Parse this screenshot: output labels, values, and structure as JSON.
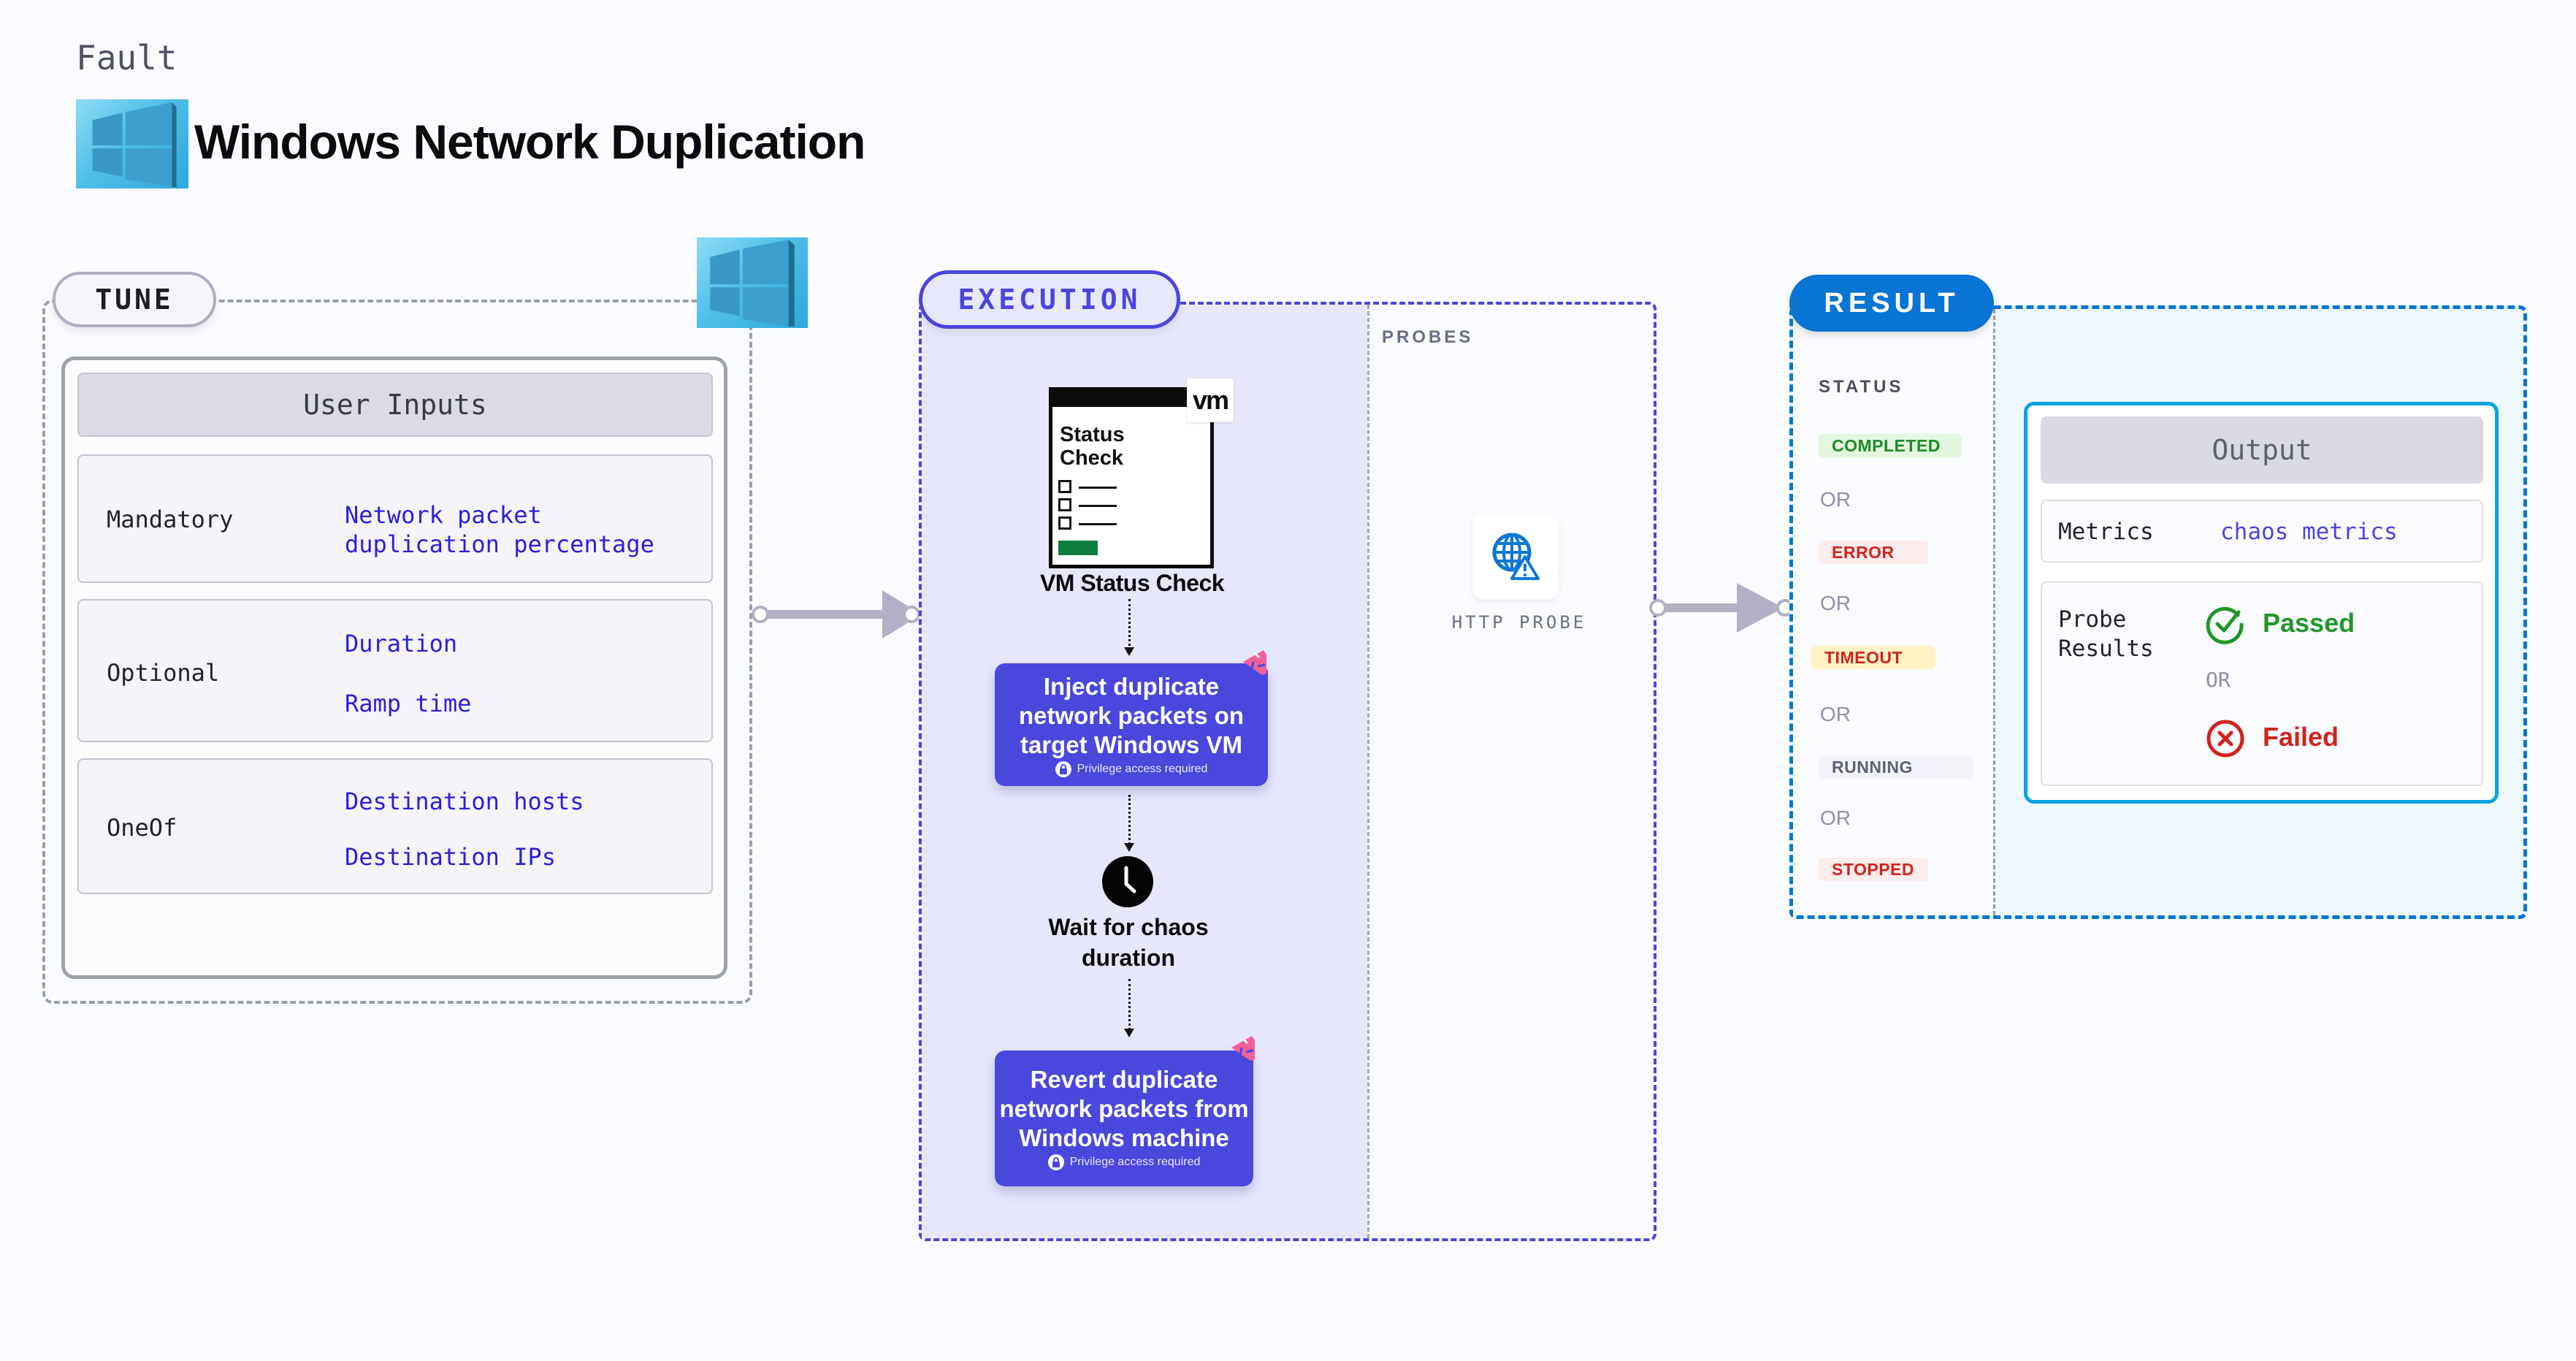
{
  "header": {
    "category": "Fault",
    "title": "Windows Network Duplication",
    "title_icon": "windows-logo-icon"
  },
  "tune": {
    "label": "TUNE",
    "icon": "windows-logo-icon",
    "card_title": "User Inputs",
    "rows": [
      {
        "label": "Mandatory",
        "values": [
          "Network packet",
          "duplication percentage"
        ]
      },
      {
        "label": "Optional",
        "values": [
          "Duration",
          "Ramp time"
        ]
      },
      {
        "label": "OneOf",
        "values": [
          "Destination hosts",
          "Destination IPs"
        ]
      }
    ]
  },
  "execution": {
    "label": "EXECUTION",
    "probes_label": "PROBES",
    "status_check": {
      "doc_title_line1": "Status",
      "doc_title_line2": "Check",
      "badge": "vm",
      "caption": "VM Status Check"
    },
    "steps": [
      {
        "title_lines": [
          "Inject duplicate",
          "network packets on",
          "target Windows VM"
        ],
        "note": "Privilege access required"
      },
      {
        "title_lines": [
          "Revert duplicate",
          "network packets from",
          "Windows machine"
        ],
        "note": "Privilege access required"
      }
    ],
    "wait": {
      "lines": [
        "Wait for chaos",
        "duration"
      ]
    },
    "probe": {
      "label": "HTTP PROBE",
      "icon": "globe-warning-icon"
    }
  },
  "result": {
    "label": "RESULT",
    "status_heading": "STATUS",
    "or_text": "OR",
    "statuses": [
      {
        "label": "COMPLETED",
        "text_color": "#1e8a2a",
        "bg_color": "#e3f6df"
      },
      {
        "label": "ERROR",
        "text_color": "#d0231f",
        "bg_color": "#fdecec"
      },
      {
        "label": "TIMEOUT",
        "text_color": "#d0231f",
        "bg_color": "#fff3c6"
      },
      {
        "label": "RUNNING",
        "text_color": "#5e6073",
        "bg_color": "#f2f3f8"
      },
      {
        "label": "STOPPED",
        "text_color": "#d0231f",
        "bg_color": "#fdecec"
      }
    ],
    "output": {
      "title": "Output",
      "metrics_label": "Metrics",
      "metrics_value": "chaos metrics",
      "probe_label_line1": "Probe",
      "probe_label_line2": "Results",
      "passed": "Passed",
      "failed": "Failed",
      "or_text": "OR"
    }
  },
  "colors": {
    "execution_accent": "#4b45de",
    "result_accent": "#0874d3",
    "passed": "#22962a",
    "failed": "#d0231f",
    "input_value": "#2c1edb"
  }
}
